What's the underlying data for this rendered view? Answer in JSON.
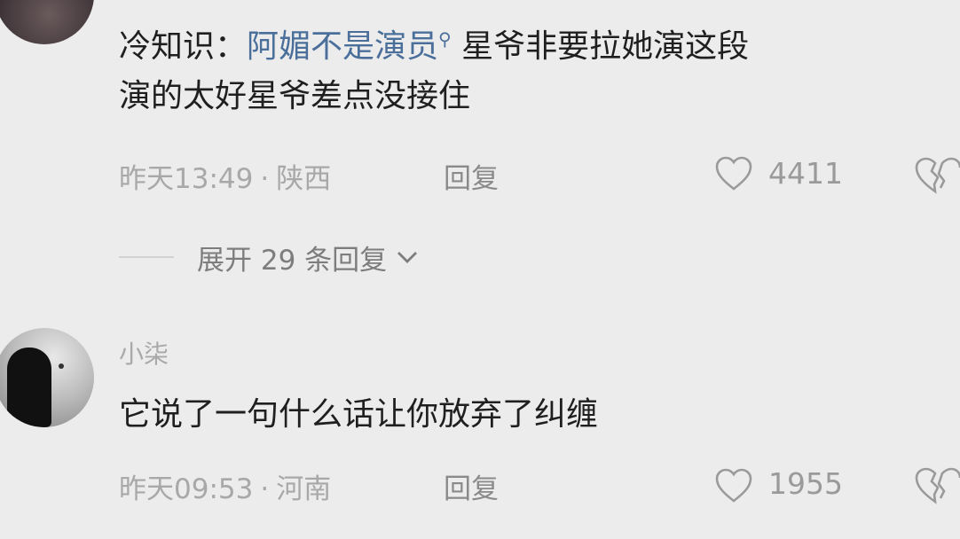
{
  "comment1": {
    "text_prefix": "冷知识：",
    "topic_link": "阿媚不是演员",
    "search_glyph": "⚲",
    "text_line1_suffix": " 星爷非要拉她演这段",
    "text_line2": "演的太好星爷差点没接住",
    "time": "昨天13:49",
    "separator": "·",
    "location": "陕西",
    "reply_label": "回复",
    "like_count": "4411",
    "expand_label": "展开 29 条回复"
  },
  "comment2": {
    "username": "小柒",
    "text": "它说了一句什么话让你放弃了纠缠",
    "time": "昨天09:53",
    "separator": "·",
    "location": "河南",
    "reply_label": "回复",
    "like_count": "1955"
  },
  "colors": {
    "background": "#ececec",
    "topic_link": "#4a6f9a",
    "meta_text": "#a8a8a8"
  }
}
